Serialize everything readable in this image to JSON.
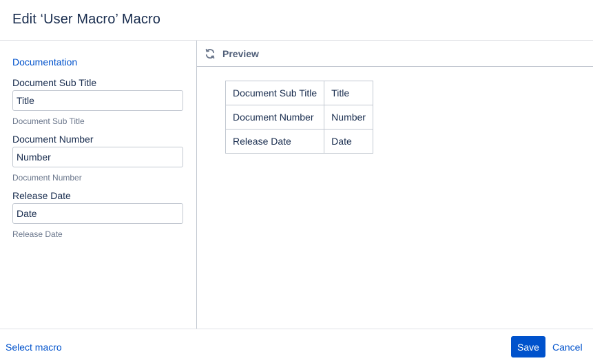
{
  "dialog": {
    "title": "Edit ‘User Macro’ Macro"
  },
  "left_panel": {
    "documentation_link": "Documentation",
    "fields": [
      {
        "label": "Document Sub Title",
        "value": "Title",
        "description": "Document Sub Title"
      },
      {
        "label": "Document Number",
        "value": "Number",
        "description": "Document Number"
      },
      {
        "label": "Release Date",
        "value": "Date",
        "description": "Release Date"
      }
    ]
  },
  "preview": {
    "title": "Preview",
    "icon": "refresh-icon",
    "table": [
      {
        "key": "Document Sub Title",
        "value": "Title"
      },
      {
        "key": "Document Number",
        "value": "Number"
      },
      {
        "key": "Release Date",
        "value": "Date"
      }
    ]
  },
  "footer": {
    "select_macro": "Select macro",
    "save": "Save",
    "cancel": "Cancel"
  },
  "colors": {
    "accent": "#0052cc",
    "text": "#172b4d",
    "muted": "#6b778c",
    "border": "#c1c7d0"
  }
}
